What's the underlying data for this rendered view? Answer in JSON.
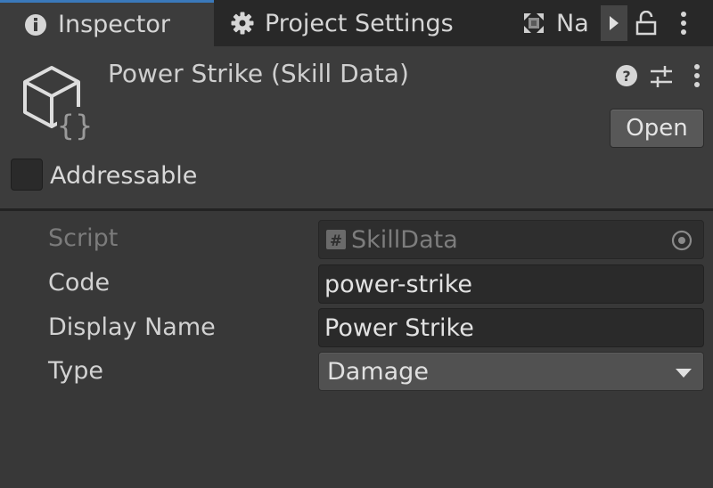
{
  "tabs": {
    "inspector": {
      "label": "Inspector",
      "icon": "info-icon",
      "active": true
    },
    "project_settings": {
      "label": "Project Settings",
      "icon": "gear-icon"
    },
    "navigation": {
      "label": "Na",
      "icon": "navigation-icon"
    }
  },
  "header": {
    "title": "Power Strike (Skill Data)",
    "icon": "scriptable-object-icon",
    "open_label": "Open",
    "addressable_label": "Addressable",
    "addressable_checked": false
  },
  "properties": [
    {
      "label": "Script",
      "value": "SkillData",
      "kind": "script",
      "disabled": true
    },
    {
      "label": "Code",
      "value": "power-strike",
      "kind": "text"
    },
    {
      "label": "Display Name",
      "value": "Power Strike",
      "kind": "text"
    },
    {
      "label": "Type",
      "value": "Damage",
      "kind": "dropdown"
    }
  ],
  "colors": {
    "accent": "#3a79bb",
    "panel": "#383838",
    "tabbar": "#282828"
  }
}
